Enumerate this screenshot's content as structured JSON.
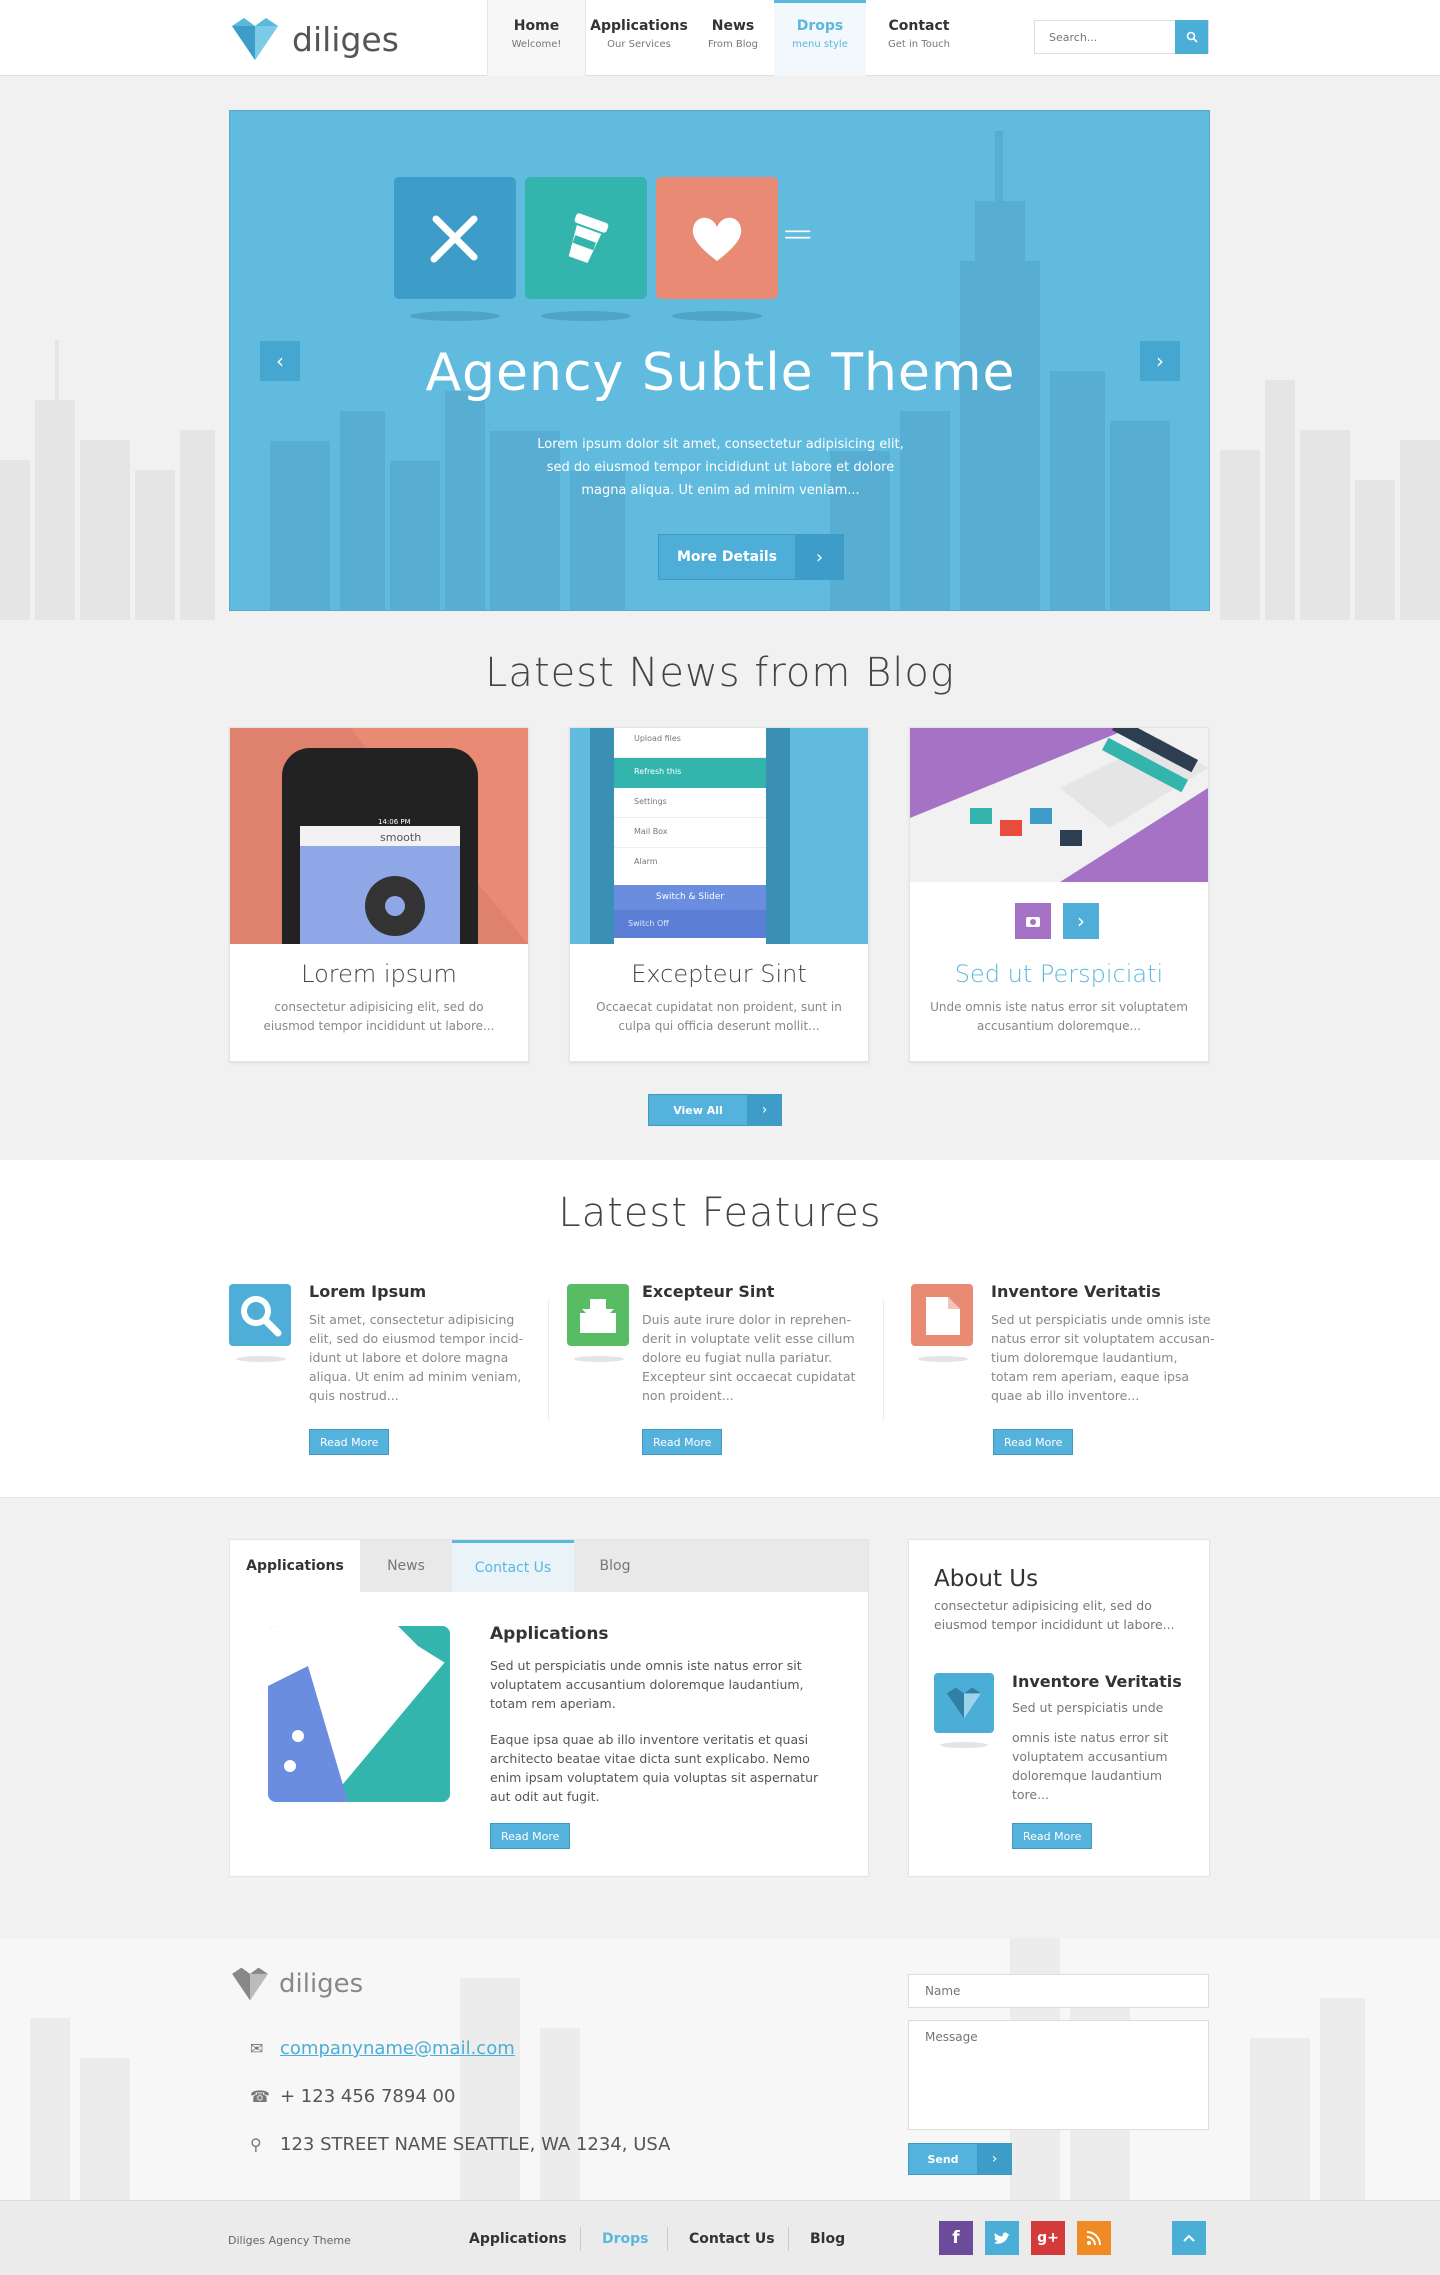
{
  "header": {
    "logo": "diliges",
    "nav": [
      {
        "title": "Home",
        "sub": "Welcome!"
      },
      {
        "title": "Applications",
        "sub": "Our Services"
      },
      {
        "title": "News",
        "sub": "From Blog"
      },
      {
        "title": "Drops",
        "sub": "menu style"
      },
      {
        "title": "Contact",
        "sub": "Get in Touch"
      }
    ],
    "search_placeholder": "Search..."
  },
  "hero": {
    "op_plus": "+",
    "op_eq": "=",
    "title": "Agency Subtle Theme",
    "text": "Lorem ipsum dolor sit amet, consectetur adipisicing elit, sed do eiusmod tempor incididunt ut labore et dolore magna aliqua. Ut enim ad minim veniam...",
    "button": "More Details"
  },
  "blog": {
    "title": "Latest News from Blog",
    "cards": [
      {
        "title": "Lorem ipsum",
        "desc": "consectetur adipisicing elit, sed do eiusmod tempor incididunt ut labore..."
      },
      {
        "title": "Excepteur Sint",
        "desc": "Occaecat cupidatat non proident, sunt in culpa qui officia deserunt mollit..."
      },
      {
        "title": "Sed ut Perspiciati",
        "desc": "Unde omnis iste natus error sit voluptatem accusantium doloremque..."
      }
    ],
    "phone_brand": "smooth",
    "phone_time": "14:06 PM",
    "menu_items": [
      "Upload files",
      "Refresh this",
      "Settings",
      "Mail Box",
      "Alarm"
    ],
    "switch_label": "Switch & Slider",
    "switch_off": "Switch Off",
    "button": "View All"
  },
  "features": {
    "title": "Latest Features",
    "items": [
      {
        "title": "Lorem Ipsum",
        "text": "Sit amet, consectetur adipisicing elit, sed do eiusmod tempor incid-idunt ut labore et dolore magna aliqua. Ut enim ad minim veniam, quis nostrud...",
        "button": "Read More"
      },
      {
        "title": "Excepteur Sint",
        "text": "Duis aute irure dolor in reprehen-derit in voluptate velit esse cillum dolore eu fugiat nulla pariatur. Excepteur sint occaecat cupidatat non proident...",
        "button": "Read More"
      },
      {
        "title": "Inventore Veritatis",
        "text": "Sed ut perspiciatis unde omnis iste natus error sit voluptatem accusan-tium doloremque laudantium, totam rem aperiam, eaque ipsa quae ab illo inventore...",
        "button": "Read More"
      }
    ]
  },
  "tabs": {
    "labels": [
      "Applications",
      "News",
      "Contact Us",
      "Blog"
    ],
    "content_title": "Applications",
    "p1": "Sed ut perspiciatis unde omnis iste natus error sit voluptatem accusantium doloremque laudantium, totam rem aperiam.",
    "p2": "Eaque ipsa quae ab illo inventore veritatis et quasi architecto beatae vitae dicta sunt explicabo. Nemo enim ipsam voluptatem quia voluptas sit aspernatur aut odit aut fugit.",
    "button": "Read More"
  },
  "about": {
    "title": "About Us",
    "text": "consectetur adipisicing elit, sed do eiusmod tempor incididunt ut labore...",
    "item_title": "Inventore Veritatis",
    "item_line": "Sed ut perspiciatis unde",
    "item_text": "omnis iste natus error sit voluptatem accusantium doloremque laudantium tore...",
    "button": "Read More"
  },
  "footer": {
    "logo": "diliges",
    "email": "companyname@mail.com",
    "phone": "+ 123 456 7894 00",
    "address": "123 STREET NAME SEATTLE, WA 1234, USA",
    "name_placeholder": "Name",
    "message_placeholder": "Message",
    "send": "Send",
    "copyright": "Diliges Agency Theme",
    "nav": [
      "Applications",
      "Drops",
      "Contact Us",
      "Blog"
    ],
    "social": [
      "f",
      "t",
      "g+",
      "rss"
    ]
  },
  "colors": {
    "accent": "#5ab8dc",
    "hero_bg": "#61bbde",
    "coral": "#e98a74",
    "teal": "#33b5ae",
    "purple": "#a572c6"
  },
  "icons": {
    "search": "search-icon",
    "prev": "chevron-left-icon",
    "next": "chevron-right-icon",
    "top": "chevron-up-icon"
  }
}
